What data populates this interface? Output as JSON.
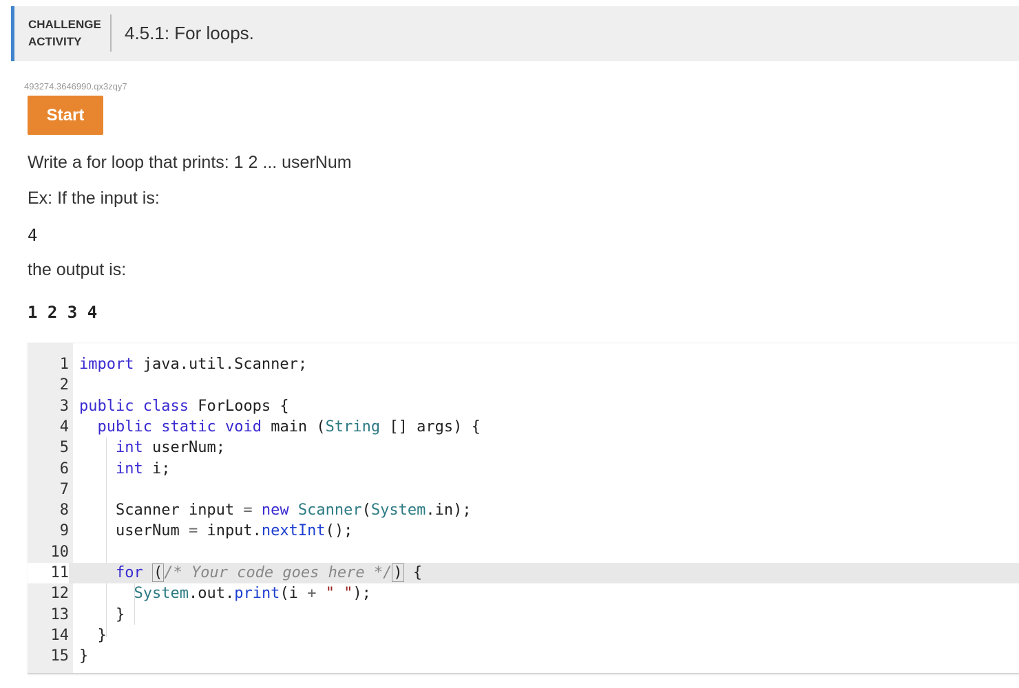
{
  "header": {
    "label_line1": "CHALLENGE",
    "label_line2": "ACTIVITY",
    "title": "4.5.1: For loops."
  },
  "activity_id": "493274.3646990.qx3zqy7",
  "start_button": "Start",
  "prompt": {
    "instruction": "Write a for loop that prints: 1 2 ... userNum",
    "example_intro": "Ex: If the input is:",
    "example_input": "4",
    "output_intro": "the output is:",
    "example_output": "1 2 3 4"
  },
  "editor": {
    "line_numbers": [
      "1",
      "2",
      "3",
      "4",
      "5",
      "6",
      "7",
      "8",
      "9",
      "10",
      "11",
      "12",
      "13",
      "14",
      "15"
    ],
    "active_line": "11",
    "lines": {
      "l1": {
        "kw": "import",
        "rest": " java.util.Scanner;"
      },
      "l3": {
        "kw1": "public",
        "kw2": "class",
        "rest": " ForLoops {"
      },
      "l4": {
        "kw1": "public",
        "kw2": "static",
        "kw3": "void",
        "mid": " main (",
        "ty": "String",
        "rest": " [] args) {"
      },
      "l5": {
        "kw": "int",
        "rest": " userNum;"
      },
      "l6": {
        "kw": "int",
        "rest": " i;"
      },
      "l8": {
        "a": "Scanner input ",
        "op": "=",
        "kw": "new",
        "ty": "Scanner",
        "b": "(",
        "ty2": "System",
        "c": ".in);"
      },
      "l9": {
        "a": "userNum ",
        "op": "=",
        "b": " input.",
        "fn": "nextInt",
        "c": "();"
      },
      "l11": {
        "kw": "for",
        "open": "(",
        "cm": "/* Your code goes here */",
        "close": ")",
        "rest": " {"
      },
      "l12": {
        "ty": "System",
        "a": ".out.",
        "fn": "print",
        "b": "(i ",
        "op": "+",
        "str": "\" \"",
        "c": ");"
      },
      "l13": "}",
      "l14": "}",
      "l15": "}"
    }
  }
}
